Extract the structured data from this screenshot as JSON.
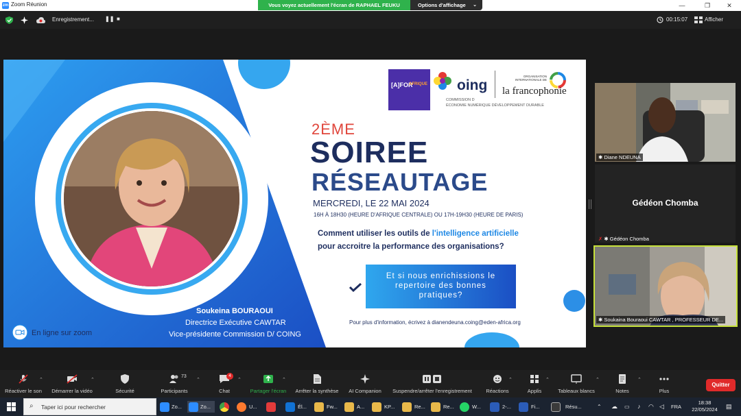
{
  "window": {
    "title": "Zoom Réunion",
    "share_banner": "Vous voyez actuellement l'écran de RAPHAEL FEUKU",
    "view_options": "Options d'affichage"
  },
  "topbar": {
    "recording": "Enregistrement...",
    "timer": "00:15:07",
    "view": "Afficher"
  },
  "slide": {
    "edition": "2ÈME",
    "title_line1": "SOIREE",
    "title_line2": "RÉSEAUTAGE",
    "date": "MERCREDI, LE 22 MAI 2024",
    "hours": "16H À 18H30 (HEURE D'AFRIQUE CENTRALE) OU 17H-19H30 (HEURE DE PARIS)",
    "question_prefix": "Comment utiliser les outils de",
    "question_highlight": "l'intelligence artificielle",
    "question_line2": "pour accroitre la performance des organisations?",
    "box_text": "Et si nous enrichissions le repertoire des bonnes pratiques?",
    "speaker_name": "Soukeina BOURAOUI",
    "speaker_role1": "Directrice Exécutive CAWTAR",
    "speaker_role2": "Vice-présidente Commission D/ COING",
    "online": "En ligne sur zoom",
    "contact": "Pour plus d'information, écrivez à dianendeuna.coing@eden-africa.org",
    "logo_afrique": "AFRIQUE",
    "logo_oing": "oing",
    "logo_commission": "COMMISSION D",
    "logo_commission_sub": "ÉCONOMIE NUMÉRIQUE DÉVELOPPEMENT DURABLE",
    "logo_oif_small": "ORGANISATION INTERNATIONALE DE",
    "logo_oif": "la francophonie"
  },
  "participants": [
    {
      "name": "Diane NDEUNA"
    },
    {
      "name": "Gédéon Chomba",
      "label": "Gédéon Chomba"
    },
    {
      "name": "Soukaina Bouraoui CAWTAR , PROFESSEUR DE..."
    }
  ],
  "toolbar": {
    "items": [
      {
        "label": "Réactiver le son"
      },
      {
        "label": "Démarrer la vidéo"
      },
      {
        "label": "Sécurité"
      },
      {
        "label": "Participants",
        "count": "73"
      },
      {
        "label": "Chat",
        "badge": "4"
      },
      {
        "label": "Partager l'écran"
      },
      {
        "label": "Arrêter la synthèse"
      },
      {
        "label": "AI Companion"
      },
      {
        "label": "Suspendre/arrêter l'enregistrement"
      },
      {
        "label": "Réactions"
      },
      {
        "label": "Applis"
      },
      {
        "label": "Tableaux blancs"
      },
      {
        "label": "Notes"
      },
      {
        "label": "Plus"
      }
    ],
    "quit": "Quitter"
  },
  "taskbar": {
    "search_placeholder": "Taper ici pour rechercher",
    "apps": [
      "Zo...",
      "Zo...",
      "U...",
      "Él...",
      "Fw...",
      "A...",
      "KP...",
      "Re...",
      "Re...",
      "W...",
      "2-...",
      "Fi...",
      "Résu..."
    ],
    "language": "FRA",
    "time": "18:38",
    "date": "22/05/2024"
  },
  "colors": {
    "accent_blue": "#1e88e5",
    "share_green": "#2fb24c",
    "quit_red": "#e02a2a",
    "slide_navy": "#1d2d5e",
    "slide_red": "#e0463c"
  }
}
